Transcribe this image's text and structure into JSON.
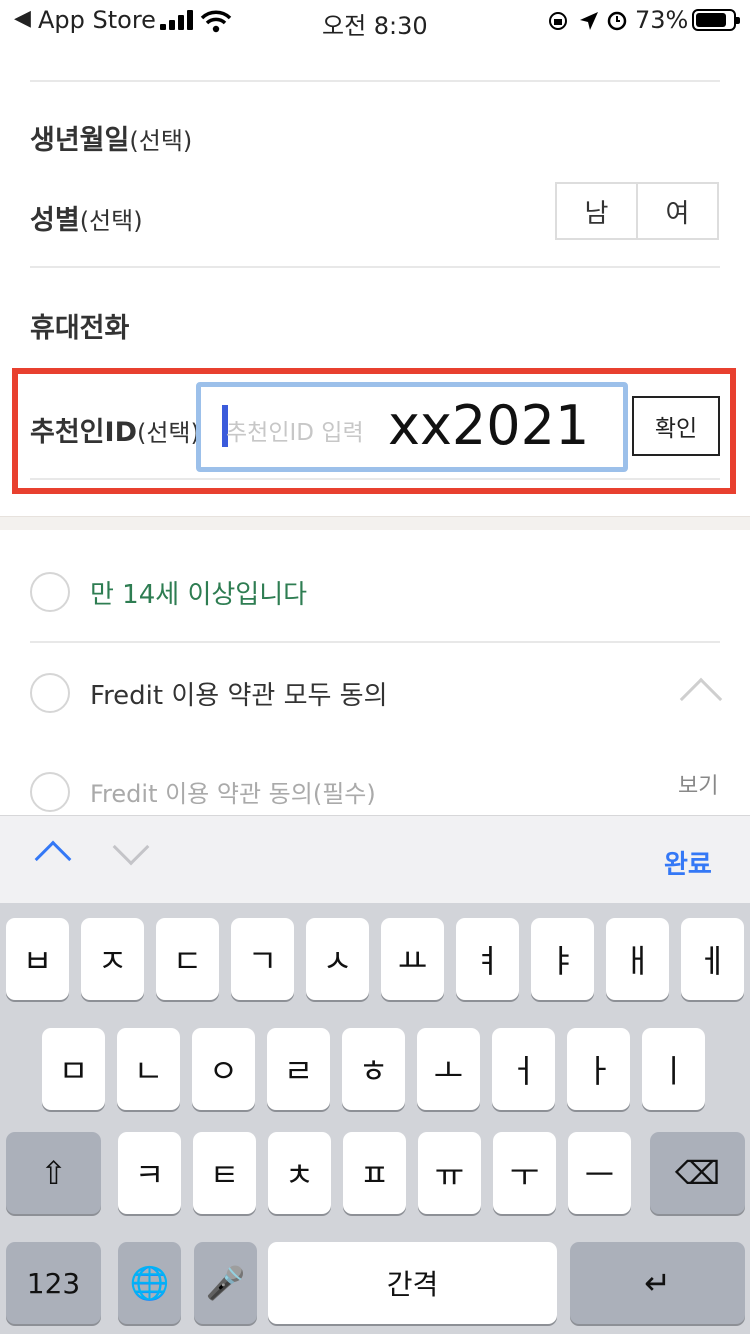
{
  "status_bar": {
    "back_label": "◀",
    "app_label": "App Store",
    "time": "오전 8:30",
    "battery": "73%"
  },
  "form": {
    "birth_label": "생년월일",
    "birth_opt": "(선택)",
    "gender_label": "성별",
    "gender_opt": "(선택)",
    "gender_options": [
      "남",
      "여"
    ],
    "phone_label": "휴대전화",
    "referrer_label": "추천인ID",
    "referrer_opt": "(선택)",
    "referrer_placeholder": "추천인ID 입력",
    "referrer_annotation": "xx2021",
    "confirm_label": "확인"
  },
  "agreements": {
    "age": "만 14세 이상입니다",
    "all": "Fredit 이용 약관 모두 동의",
    "terms": "Fredit 이용 약관 동의(필수)",
    "view": "보기"
  },
  "toolbar": {
    "done_label": "완료"
  },
  "keyboard": {
    "row1": [
      "ㅂ",
      "ㅈ",
      "ㄷ",
      "ㄱ",
      "ㅅ",
      "ㅛ",
      "ㅕ",
      "ㅑ",
      "ㅐ",
      "ㅔ"
    ],
    "row2": [
      "ㅁ",
      "ㄴ",
      "ㅇ",
      "ㄹ",
      "ㅎ",
      "ㅗ",
      "ㅓ",
      "ㅏ",
      "ㅣ"
    ],
    "row3": [
      "ㅋ",
      "ㅌ",
      "ㅊ",
      "ㅍ",
      "ㅠ",
      "ㅜ",
      "ㅡ"
    ],
    "shift": "⇧",
    "delete": "⌫",
    "numbers": "123",
    "globe": "🌐",
    "mic": "🎤",
    "space": "간격",
    "return": "↵"
  },
  "colors": {
    "highlight": "#e8402f",
    "accent": "#3478f6",
    "agree_age": "#2e7d52",
    "input_border": "#9cc0ea"
  }
}
